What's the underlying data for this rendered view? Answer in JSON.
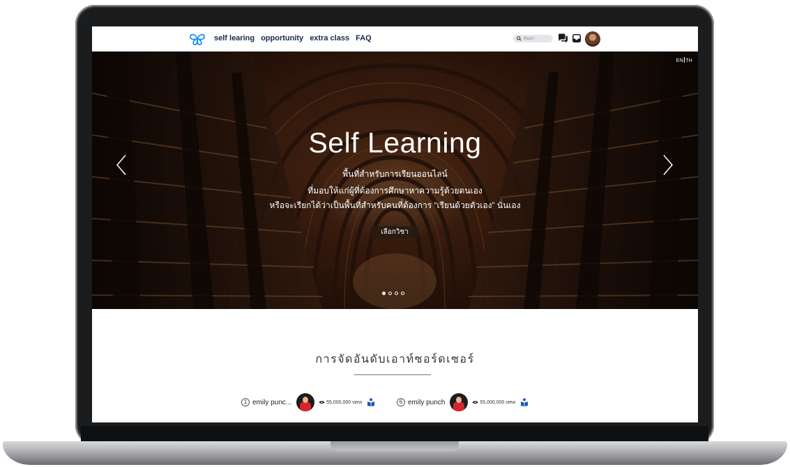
{
  "nav": {
    "links": [
      "self learing",
      "opportunity",
      "extra class",
      "FAQ"
    ],
    "search_placeholder": "ค้นหา"
  },
  "hero": {
    "lang_en": "EN",
    "lang_th": "TH",
    "title": "Self Learning",
    "subtitle_lines": [
      "พื้นที่สำหรับการเรียนออนไลน์",
      "ที่มอบให้แก่ผู้ที่ต้องการศึกษาหาความรู้ด้วยตนเอง",
      "หรือจะเรียกได้ว่าเป็นพื้นที่สำหรับคนที่ต้องการ “เรียนด้วยตัวเอง” นั่นเอง"
    ],
    "button_label": "เลือกวิชา",
    "slide_count": 4,
    "active_slide": 1
  },
  "ranking": {
    "title": "การจัดอันดับเอาท์ซอร์ดเซอร์",
    "items": [
      {
        "rank": "1",
        "name": "emily punc...",
        "views": "55,000,000 view"
      },
      {
        "rank": "6",
        "name": "emily punch",
        "views": "55,000,000 view"
      }
    ]
  },
  "colors": {
    "nav_text": "#1a2a4a",
    "logo_blue": "#1e90ff",
    "hero_text": "#ffffff",
    "reader_icon": "#1a5ab8"
  }
}
